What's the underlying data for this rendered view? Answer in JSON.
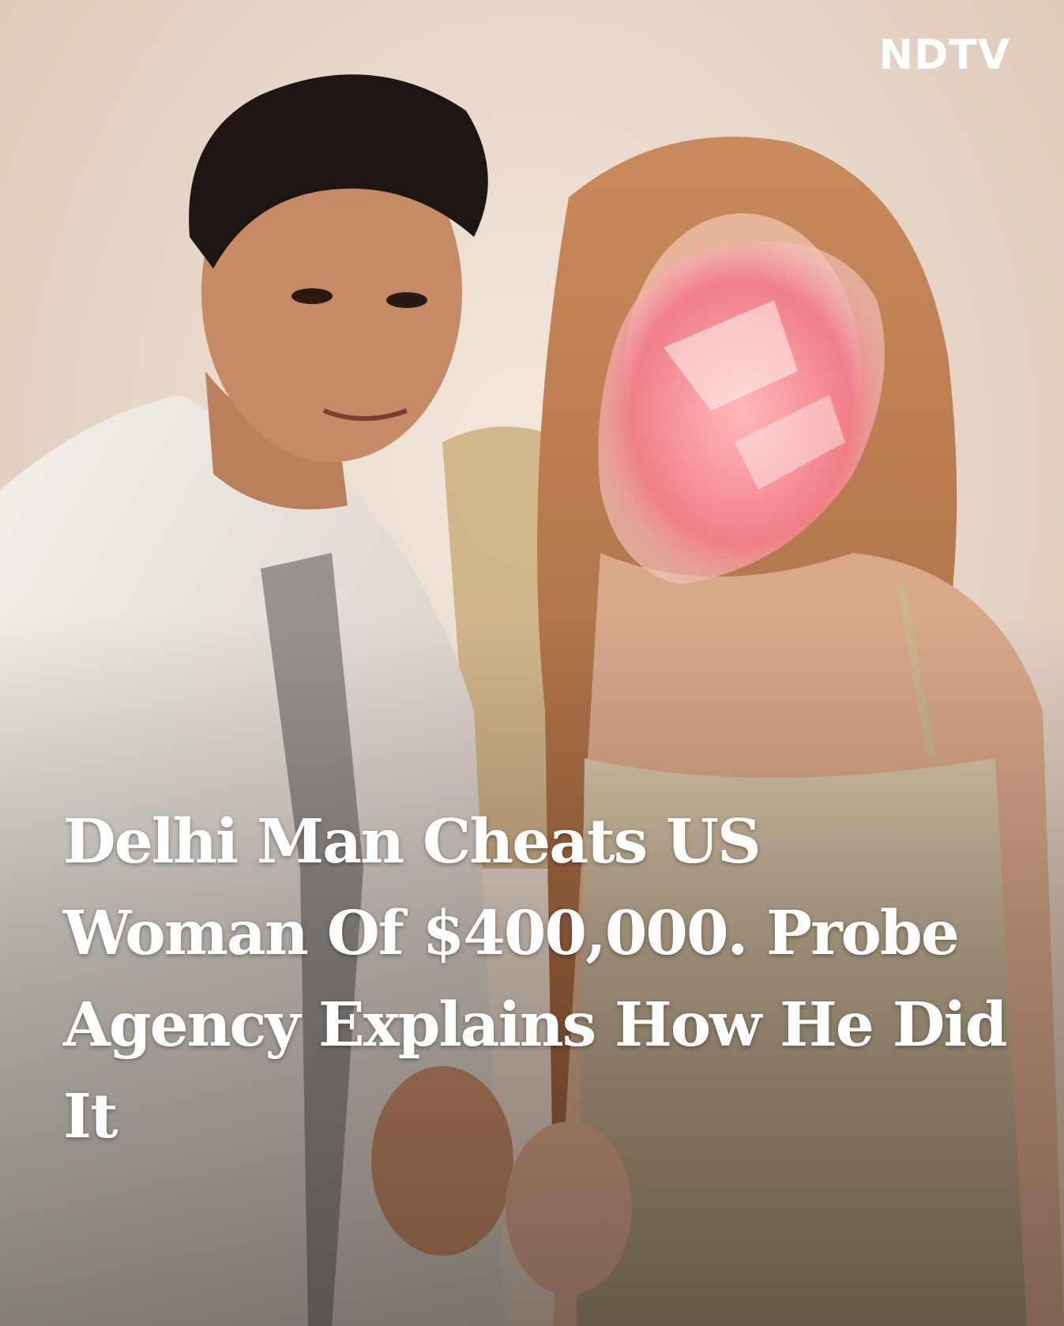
{
  "brand": {
    "logo_text": "NDTV",
    "accent": "#e21b22"
  },
  "headline": "Delhi Man Cheats US Woman Of $400,000. Probe Agency Explains How He Did It",
  "colors": {
    "headline_text": "#ffffff",
    "face_blur_overlay": "#f08a90"
  }
}
